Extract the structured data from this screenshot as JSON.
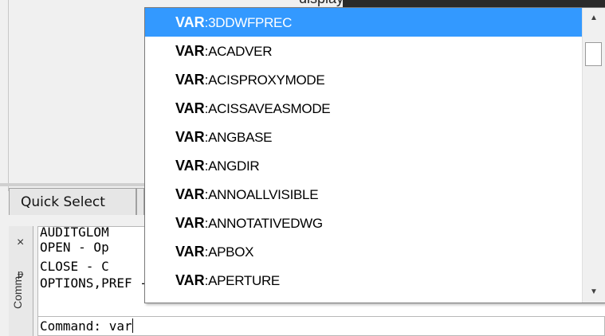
{
  "top": {
    "caption": "display"
  },
  "quick_select_tab": {
    "label": "Quick Select"
  },
  "command_panel": {
    "close_glyph": "×",
    "pin_glyph": "ᵽ",
    "vertical_label": "Comm",
    "history": [
      "AUDITGLOM",
      "OPEN - Op",
      "CLOSE - C",
      "OPTIONS,PREF - Preferences"
    ],
    "prompt": "Command: var"
  },
  "autocomplete": {
    "prefix": "VAR",
    "items": [
      {
        "name": ":3DDWFPREC",
        "selected": true
      },
      {
        "name": ":ACADVER"
      },
      {
        "name": ":ACISPROXYMODE"
      },
      {
        "name": ":ACISSAVEASMODE"
      },
      {
        "name": ":ANGBASE"
      },
      {
        "name": ":ANGDIR"
      },
      {
        "name": ":ANNOALLVISIBLE"
      },
      {
        "name": ":ANNOTATIVEDWG"
      },
      {
        "name": ":APBOX"
      },
      {
        "name": ":APERTURE"
      }
    ],
    "scroll": {
      "up_glyph": "▲",
      "down_glyph": "▼"
    }
  },
  "colors": {
    "selection": "#3399ff",
    "panel": "#f0f0f0"
  }
}
